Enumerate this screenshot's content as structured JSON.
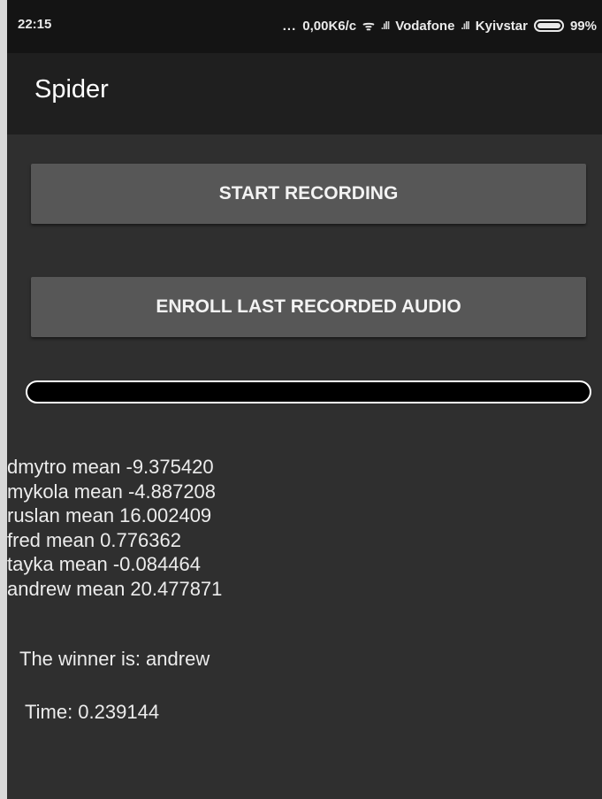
{
  "status_bar": {
    "time": "22:15",
    "activity_dots": "...",
    "speed": "0,00K6/c",
    "carrier1": "Vodafone",
    "carrier2": "Kyivstar",
    "battery": "99%",
    "signal_glyph": ".ıll",
    "wifi_glyph": "ᯤ"
  },
  "app": {
    "title": "Spider"
  },
  "buttons": {
    "start_recording": "START RECORDING",
    "enroll": "ENROLL LAST RECORDED AUDIO"
  },
  "progress": {
    "value": 0
  },
  "results": [
    "dmytro  mean  -9.375420",
    "mykola  mean  -4.887208",
    "ruslan  mean  16.002409",
    "fred  mean  0.776362",
    "tayka  mean  -0.084464",
    "andrew  mean  20.477871"
  ],
  "winner_text": "The winner is: andrew",
  "time_text": "Time:  0.239144",
  "colors": {
    "background": "#2f2f2f",
    "toolbar": "#1f1f1f",
    "button": "#575757",
    "text": "#ececec"
  }
}
